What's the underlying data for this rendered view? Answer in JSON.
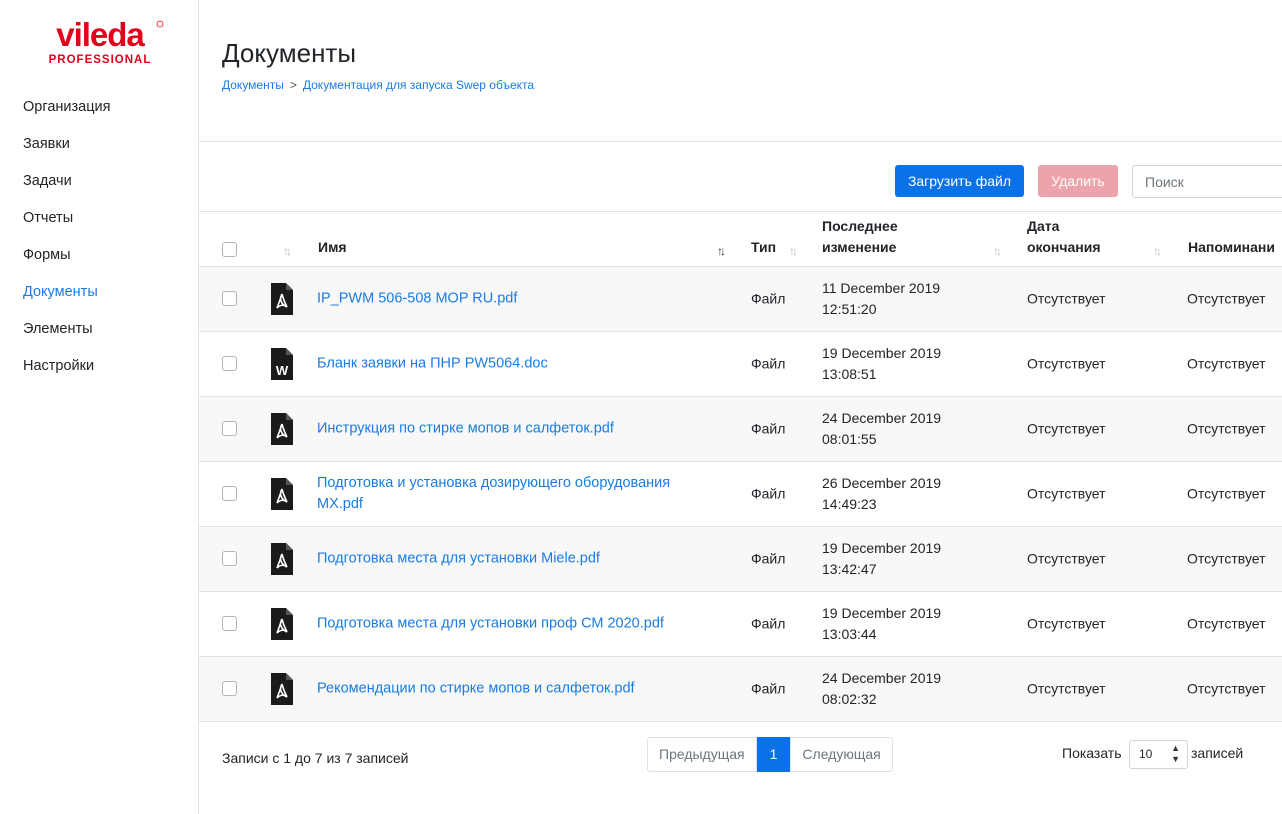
{
  "brand": {
    "logo_text": "vileda",
    "logo_sub": "PROFESSIONAL",
    "color": "#e2001a"
  },
  "sidebar": {
    "items": [
      {
        "label": "Организация"
      },
      {
        "label": "Заявки"
      },
      {
        "label": "Задачи"
      },
      {
        "label": "Отчеты"
      },
      {
        "label": "Формы"
      },
      {
        "label": "Документы",
        "active": true
      },
      {
        "label": "Элементы"
      },
      {
        "label": "Настройки"
      }
    ]
  },
  "header": {
    "title": "Документы",
    "breadcrumb": [
      "Документы",
      "Документация для запуска Swep объекта"
    ],
    "breadcrumb_sep": ">"
  },
  "toolbar": {
    "upload_label": "Загрузить файл",
    "delete_label": "Удалить",
    "search_placeholder": "Поиск"
  },
  "table": {
    "columns": {
      "name": "Имя",
      "type": "Тип",
      "modified": "Последнее изменение",
      "end_date": "Дата окончания",
      "reminder": "Напоминани"
    },
    "rows": [
      {
        "icon": "pdf-icon",
        "name": "IP_PWM 506-508 MOP RU.pdf",
        "type": "Файл",
        "date": "11 December 2019",
        "time": "12:51:20",
        "end": "Отсутствует",
        "reminder": "Отсутствует"
      },
      {
        "icon": "word-icon",
        "name": "Бланк заявки на ПНР PW5064.doc",
        "type": "Файл",
        "date": "19 December 2019",
        "time": "13:08:51",
        "end": "Отсутствует",
        "reminder": "Отсутствует"
      },
      {
        "icon": "pdf-icon",
        "name": "Инструкция по стирке мопов и салфеток.pdf",
        "type": "Файл",
        "date": "24 December 2019",
        "time": "08:01:55",
        "end": "Отсутствует",
        "reminder": "Отсутствует"
      },
      {
        "icon": "pdf-icon",
        "name": "Подготовка и установка дозирующего оборудования MX.pdf",
        "type": "Файл",
        "date": "26 December 2019",
        "time": "14:49:23",
        "end": "Отсутствует",
        "reminder": "Отсутствует"
      },
      {
        "icon": "pdf-icon",
        "name": "Подготовка места для установки Miele.pdf",
        "type": "Файл",
        "date": "19 December 2019",
        "time": "13:42:47",
        "end": "Отсутствует",
        "reminder": "Отсутствует"
      },
      {
        "icon": "pdf-icon",
        "name": "Подготовка места для установки проф СМ 2020.pdf",
        "type": "Файл",
        "date": "19 December 2019",
        "time": "13:03:44",
        "end": "Отсутствует",
        "reminder": "Отсутствует"
      },
      {
        "icon": "pdf-icon",
        "name": "Рекомендации по стирке мопов и салфеток.pdf",
        "type": "Файл",
        "date": "24 December 2019",
        "time": "08:02:32",
        "end": "Отсутствует",
        "reminder": "Отсутствует"
      }
    ]
  },
  "footer": {
    "info": "Записи с 1 до 7 из 7 записей",
    "prev_label": "Предыдущая",
    "current_page": "1",
    "next_label": "Следующая",
    "length_before": "Показать",
    "length_value": "10",
    "length_after": "записей"
  },
  "colors": {
    "accent": "#0a72e6",
    "link": "#1a7ce2",
    "delete_disabled": "#eda3ab"
  }
}
